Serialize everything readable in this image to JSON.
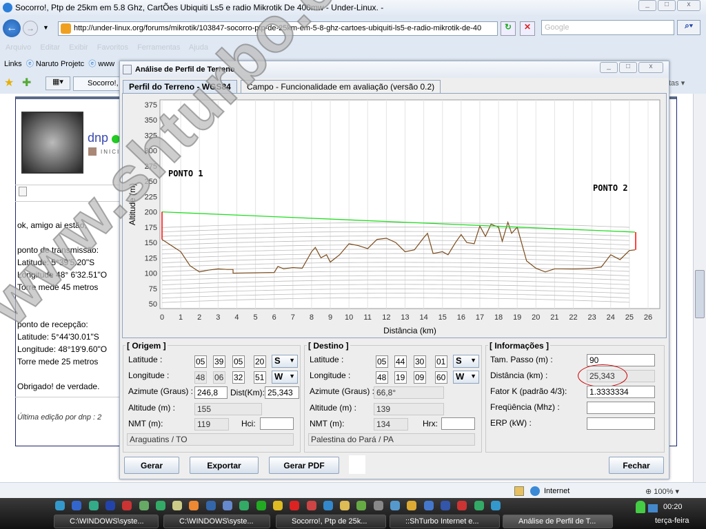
{
  "browser": {
    "title": "Socorro!, Ptp de 25km em 5.8 Ghz, CartÕes Ubiquiti Ls5 e radio Mikrotik De 400mw - Under-Linux. -",
    "url": "http://under-linux.org/forums/mikrotik/103847-socorro-ptp-de-25km-em-5-8-ghz-cartoes-ubiquiti-ls5-e-radio-mikrotik-de-40",
    "search_placeholder": "Google",
    "menu": [
      "Arquivo",
      "Editar",
      "Exibir",
      "Favoritos",
      "Ferramentas",
      "Ajuda"
    ],
    "links_label": "Links",
    "links": [
      "Naruto Projetc",
      "www"
    ],
    "tab": "Socorro!, ",
    "right_tab": "tas",
    "status_zone": "Internet",
    "zoom": "100%"
  },
  "post": {
    "user": "dnp",
    "rank": "INICI",
    "lines": [
      "ok, amigo ai estão,",
      "ponto de transmissão:",
      "Latitude: 5°39'5.20\"S",
      "Longitude 48° 6'32.51\"O",
      "Torre mede 45 metros",
      "ponto de recepção:",
      "Latitude: 5°44'30.01\"S",
      "Longitude: 48°19'9.60\"O",
      "Torre mede 25 metros",
      "Obrigado! de verdade."
    ],
    "edit": "Última edição por dnp : 2"
  },
  "dialog": {
    "title": "Análise de Perfil de Terreno",
    "tabs": [
      "Perfil do Terreno - WGS84",
      "Campo - Funcionalidade em avaliação (versão 0.2)"
    ],
    "origem": {
      "title": "[ Origem ]",
      "lat_label": "Latitude :",
      "lat": [
        "05",
        "39",
        "05",
        "20"
      ],
      "lat_hem": "S",
      "lon_label": "Longitude :",
      "lon": [
        "48",
        "06",
        "32",
        "51"
      ],
      "lon_hem": "W",
      "azim_label": "Azimute (Graus) :",
      "azim": "246,8",
      "dist_label": "Dist(Km):",
      "dist": "25,343",
      "alt_label": "Altitude (m) :",
      "alt": "155",
      "nmt_label": "NMT (m):",
      "nmt": "119",
      "h_label": "Hci:",
      "h": "",
      "place": "Araguatins / TO"
    },
    "destino": {
      "title": "[ Destino ]",
      "lat_label": "Latitude :",
      "lat": [
        "05",
        "44",
        "30",
        "01"
      ],
      "lat_hem": "S",
      "lon_label": "Longitude :",
      "lon": [
        "48",
        "19",
        "09",
        "60"
      ],
      "lon_hem": "W",
      "azim_label": "Azimute (Graus) :",
      "azim": "66,8°",
      "alt_label": "Altitude (m) :",
      "alt": "139",
      "nmt_label": "NMT (m):",
      "nmt": "134",
      "h_label": "Hrx:",
      "h": "",
      "place": "Palestina do Pará / PA"
    },
    "info": {
      "title": "[ Informações ]",
      "rows": [
        {
          "label": "Tam. Passo (m) :",
          "value": "90"
        },
        {
          "label": "Distância (km) :",
          "value": "25,343"
        },
        {
          "label": "Fator K (padrão 4/3):",
          "value": "1.3333334"
        },
        {
          "label": "Freqüência (Mhz) :",
          "value": ""
        },
        {
          "label": "ERP (kW) :",
          "value": ""
        }
      ]
    },
    "buttons": {
      "gerar": "Gerar",
      "exportar": "Exportar",
      "pdf": "Gerar PDF",
      "fechar": "Fechar"
    }
  },
  "chart_data": {
    "type": "line",
    "xlabel": "Distância (km)",
    "ylabel": "Altitude (m)",
    "xlim": [
      0,
      26
    ],
    "ylim": [
      50,
      375
    ],
    "xticks": [
      0,
      1,
      2,
      3,
      4,
      5,
      6,
      7,
      8,
      9,
      10,
      11,
      12,
      13,
      14,
      15,
      16,
      17,
      18,
      19,
      20,
      21,
      22,
      23,
      24,
      25,
      26
    ],
    "yticks": [
      50,
      75,
      100,
      125,
      150,
      175,
      200,
      225,
      250,
      275,
      300,
      325,
      350,
      375
    ],
    "annotations": [
      "PONTO 1",
      "PONTO 2"
    ],
    "terrain": {
      "x": [
        0,
        0.5,
        1,
        1.5,
        2,
        2.5,
        3,
        3.5,
        3.8,
        3.8,
        6,
        6.2,
        6.5,
        7,
        7.5,
        8,
        8.2,
        8.5,
        8.8,
        9,
        9.5,
        10,
        10.5,
        11,
        11.5,
        12,
        12.5,
        13,
        13.5,
        14,
        14.2,
        14.5,
        15,
        15.3,
        15.7,
        16,
        16.3,
        16.7,
        17,
        17.3,
        17.6,
        18,
        18.2,
        18.5,
        18.7,
        19,
        19.5,
        20,
        20.5,
        21,
        22,
        23,
        23.5,
        24,
        24.5,
        25,
        25.3
      ],
      "y": [
        155,
        145,
        135,
        112,
        102,
        105,
        107,
        106,
        106,
        100,
        101,
        111,
        107,
        109,
        108,
        135,
        142,
        125,
        130,
        118,
        130,
        148,
        145,
        140,
        155,
        157,
        150,
        135,
        138,
        158,
        165,
        132,
        135,
        130,
        150,
        163,
        150,
        148,
        177,
        160,
        180,
        175,
        152,
        183,
        165,
        175,
        120,
        108,
        102,
        107,
        107,
        108,
        110,
        130,
        122,
        137,
        138
      ]
    },
    "los": {
      "x": [
        0,
        25.3
      ],
      "y": [
        200,
        167
      ]
    },
    "towers": [
      {
        "x": 0,
        "ground": 155,
        "top": 200
      },
      {
        "x": 25.3,
        "ground": 138,
        "top": 167
      }
    ],
    "colors": {
      "terrain": "#7a4a1a",
      "los": "#22dd22",
      "tower": "#ff0000"
    }
  },
  "watermark": "www.shturbo.com.br",
  "taskbar": {
    "tasks": [
      "C:\\WINDOWS\\syste...",
      "C:\\WINDOWS\\syste...",
      "Socorro!, Ptp de 25k...",
      "::ShTurbo Internet e...",
      "Análise de Perfil de T..."
    ],
    "time": "00:20",
    "day": "terça-feira"
  }
}
